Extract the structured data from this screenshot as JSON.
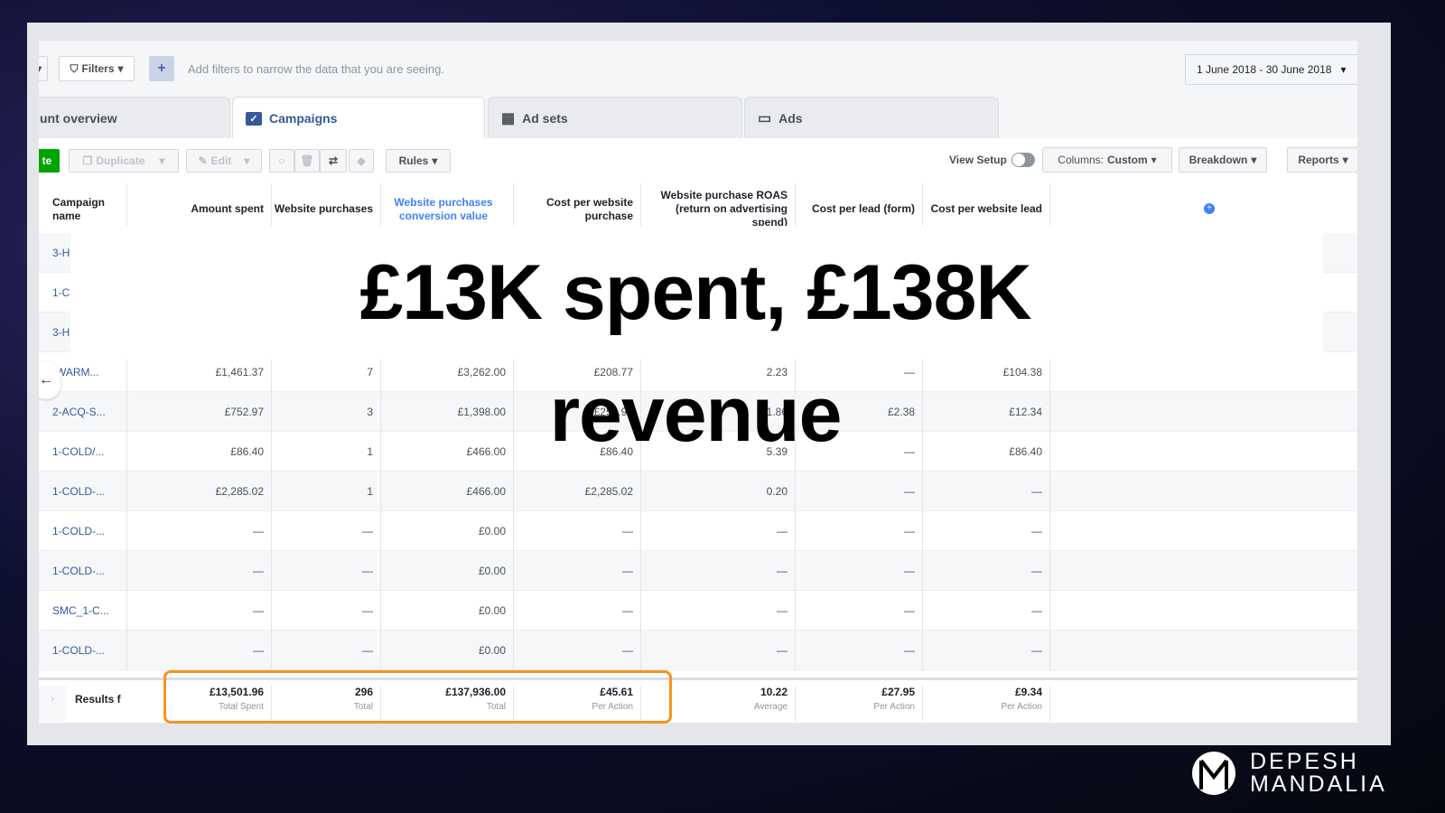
{
  "filters": {
    "filters_label": "Filters",
    "add_label": "+",
    "hint": "Add filters to narrow the data that you are seeing.",
    "date_range": "1 June 2018 - 30 June 2018"
  },
  "tabs": [
    {
      "label": "unt overview",
      "icon": "none"
    },
    {
      "label": "Campaigns",
      "icon": "folder-check-icon"
    },
    {
      "label": "Ad sets",
      "icon": "grid-icon"
    },
    {
      "label": "Ads",
      "icon": "ad-icon"
    }
  ],
  "toolbar": {
    "create_label": "te",
    "duplicate_label": "Duplicate",
    "edit_label": "Edit",
    "rules_label": "Rules",
    "view_setup_label": "View Setup",
    "columns_label": "Columns:",
    "columns_value": "Custom",
    "breakdown_label": "Breakdown",
    "reports_label": "Reports"
  },
  "columns": [
    "Campaign name",
    "Amount spent",
    "Website purchases",
    "Website purchases conversion value",
    "Cost per website purchase",
    "Website purchase ROAS (return on advertising spend)",
    "Cost per lead (form)",
    "Cost per website lead"
  ],
  "rows": [
    [
      "3-H",
      "",
      "",
      "",
      "",
      "",
      "",
      ""
    ],
    [
      "1-C",
      "",
      "",
      "",
      "",
      "",
      "",
      ""
    ],
    [
      "3-H",
      "",
      "",
      "",
      "",
      "",
      "",
      ""
    ],
    [
      "-WARM...",
      "£1,461.37",
      "7",
      "£3,262.00",
      "£208.77",
      "2.23",
      "—",
      "£104.38"
    ],
    [
      "2-ACQ-S...",
      "£752.97",
      "3",
      "£1,398.00",
      "£250.99",
      "1.86",
      "£2.38",
      "£12.34"
    ],
    [
      "1-COLD/...",
      "£86.40",
      "1",
      "£466.00",
      "£86.40",
      "5.39",
      "—",
      "£86.40"
    ],
    [
      "1-COLD-...",
      "£2,285.02",
      "1",
      "£466.00",
      "£2,285.02",
      "0.20",
      "—",
      "—"
    ],
    [
      "1-COLD-...",
      "—",
      "—",
      "£0.00",
      "—",
      "—",
      "—",
      "—"
    ],
    [
      "1-COLD-...",
      "—",
      "—",
      "£0.00",
      "—",
      "—",
      "—",
      "—"
    ],
    [
      "SMC_1-C...",
      "—",
      "—",
      "£0.00",
      "—",
      "—",
      "—",
      "—"
    ],
    [
      "1-COLD-...",
      "—",
      "—",
      "£0.00",
      "—",
      "—",
      "—",
      "—"
    ]
  ],
  "footer": {
    "label": "Results f",
    "cells": [
      {
        "value": "£13,501.96",
        "label": "Total Spent"
      },
      {
        "value": "296",
        "label": "Total"
      },
      {
        "value": "£137,936.00",
        "label": "Total"
      },
      {
        "value": "£45.61",
        "label": "Per Action"
      },
      {
        "value": "10.22",
        "label": "Average"
      },
      {
        "value": "£27.95",
        "label": "Per Action"
      },
      {
        "value": "£9.34",
        "label": "Per Action"
      }
    ]
  },
  "headline": {
    "line1": "£13K spent, £138K",
    "line2": "revenue"
  },
  "brand": {
    "line1": "DEPESH",
    "line2": "MANDALIA"
  },
  "colors": {
    "highlight": "#f7931e",
    "link": "#365899",
    "create": "#00a400"
  }
}
